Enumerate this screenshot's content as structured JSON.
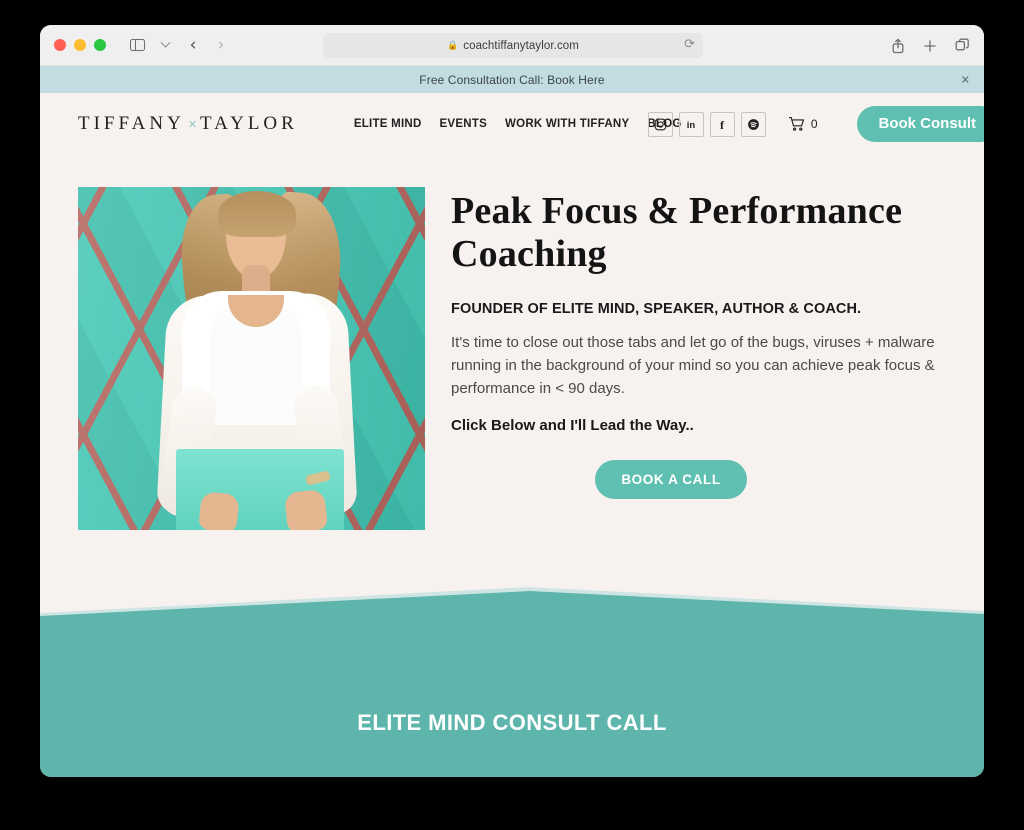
{
  "browser": {
    "url": "coachtiffanytaylor.com",
    "lock_icon": "lock-icon",
    "reload_icon": "reload-icon",
    "back_icon": "back-arrow-icon",
    "forward_icon": "forward-arrow-icon",
    "sidebar_icon": "sidebar-toggle-icon",
    "tabgroup_icon": "chevron-down-icon",
    "share_icon": "share-icon",
    "newtab_icon": "plus-icon",
    "tabs_icon": "tab-overview-icon"
  },
  "promo": {
    "text": "Free Consultation Call: Book Here",
    "close_label": "✕"
  },
  "header": {
    "logo_first": "TIFFANY",
    "logo_mark": "✕",
    "logo_last": "TAYLOR",
    "nav": [
      {
        "label": "ELITE MIND"
      },
      {
        "label": "EVENTS"
      },
      {
        "label": "WORK WITH TIFFANY"
      },
      {
        "label": "BLOG"
      }
    ],
    "socials": [
      {
        "name": "instagram-icon",
        "title": "Instagram"
      },
      {
        "name": "linkedin-icon",
        "title": "LinkedIn"
      },
      {
        "name": "facebook-icon",
        "title": "Facebook"
      },
      {
        "name": "spotify-icon",
        "title": "Spotify"
      }
    ],
    "cart_count": "0",
    "book_consult_label": "Book Consult"
  },
  "hero": {
    "image_alt": "Tiffany Taylor standing in front of a teal diamond-pattern wall holding a teal box",
    "headline": "Peak Focus & Performance Coaching",
    "eyebrow": "FOUNDER OF ELITE MIND, SPEAKER, AUTHOR & COACH.",
    "body": "It's time to close out those tabs and let go of the bugs, viruses + malware running in the background of your mind so you can achieve peak focus & performance in < 90 days.",
    "kicker": "Click Below and I'll Lead the Way..",
    "cta_label": "BOOK A CALL"
  },
  "teal_section": {
    "title": "ELITE MIND CONSULT CALL"
  },
  "colors": {
    "page_bg": "#F7F2EF",
    "promo_bg": "#C3DCE1",
    "teal": "#5EB5AC",
    "button_teal": "#5FBFB1",
    "text_dark": "#231F20",
    "body_text": "#4A4A4A"
  }
}
